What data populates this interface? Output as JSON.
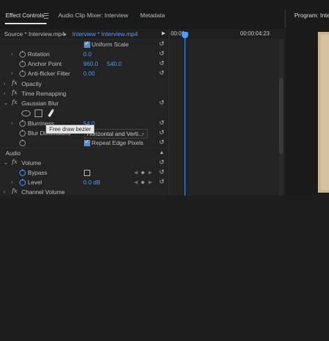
{
  "tabs": {
    "effect_controls": "Effect Controls",
    "audio_clip_mixer": "Audio Clip Mixer: Interview",
    "metadata": "Metadata",
    "program": "Program: Interview"
  },
  "source": {
    "source_label": "Source * Interview.mp4",
    "sequence_label": "Interview * Interview.mp4"
  },
  "timeline": {
    "start": "00:00",
    "end": "00:00:04:23"
  },
  "motion": {
    "uniform_scale_label": "Uniform Scale",
    "uniform_scale_checked": true,
    "rotation_label": "Rotation",
    "rotation_value": "0.0",
    "anchor_label": "Anchor Point",
    "anchor_x": "960.0",
    "anchor_y": "540.0",
    "antiflicker_label": "Anti-flicker Filter",
    "antiflicker_value": "0.00"
  },
  "opacity_label": "Opacity",
  "time_remapping_label": "Time Remapping",
  "gaussian_blur": {
    "label": "Gaussian Blur",
    "tooltip": "Free draw bezier",
    "blurriness_label": "Blurriness",
    "blurriness_value": "54.0",
    "blur_dimensions_label": "Blur Dimensions",
    "blur_dimensions_value": "Horizontal and Verti...",
    "repeat_edge_label": "Repeat Edge Pixels",
    "repeat_edge_checked": true
  },
  "audio": {
    "section_label": "Audio",
    "volume_label": "Volume",
    "bypass_label": "Bypass",
    "level_label": "Level",
    "level_value": "0.0 dB",
    "channel_volume_label": "Channel Volume"
  },
  "icons": {
    "reset": "reset-icon",
    "stopwatch": "stopwatch-icon",
    "pen": "pen-tool-icon"
  },
  "colors": {
    "accent": "#4a9eff",
    "panel": "#232323",
    "background": "#1d1d1d"
  }
}
